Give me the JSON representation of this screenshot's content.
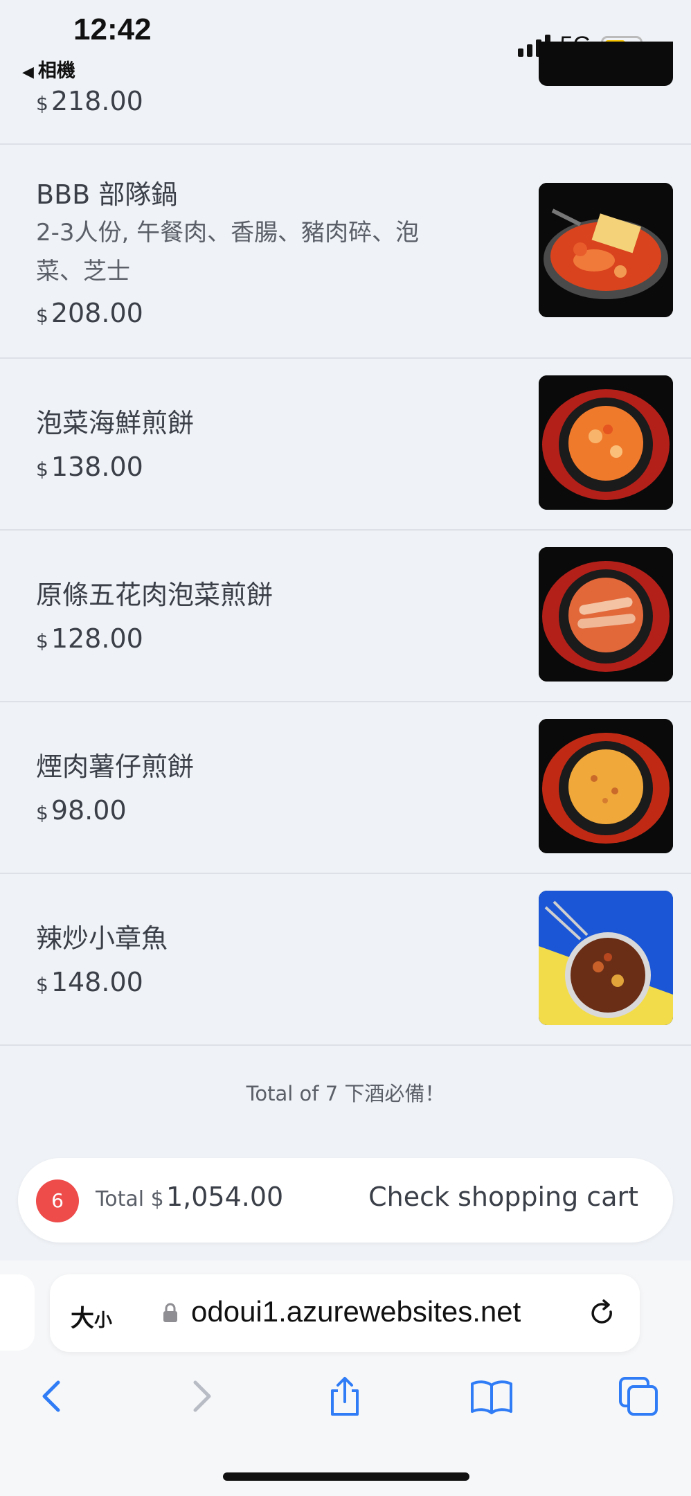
{
  "status_bar": {
    "time": "12:42",
    "back_app": "相機",
    "network": "5G"
  },
  "top_item": {
    "price_currency": "$",
    "price": "218.00"
  },
  "items": [
    {
      "name": "BBB 部隊鍋",
      "desc": "2-3人份, 午餐肉、香腸、豬肉碎、泡菜、芝士",
      "currency": "$",
      "price": "208.00",
      "image": "army-stew-photo"
    },
    {
      "name": "泡菜海鮮煎餅",
      "currency": "$",
      "price": "138.00",
      "image": "kimchi-seafood-pancake-photo"
    },
    {
      "name": "原條五花肉泡菜煎餅",
      "currency": "$",
      "price": "128.00",
      "image": "pork-belly-kimchi-pancake-photo"
    },
    {
      "name": "煙肉薯仔煎餅",
      "currency": "$",
      "price": "98.00",
      "image": "bacon-potato-pancake-photo"
    },
    {
      "name": "辣炒小章魚",
      "currency": "$",
      "price": "148.00",
      "image": "spicy-octopus-photo"
    }
  ],
  "footer_text": "Total of 7 下酒必備！",
  "cart": {
    "count": "6",
    "total_label": "Total $",
    "total_value": "1,054.00",
    "button_label": "Check shopping cart"
  },
  "browser": {
    "text_size_label": "大",
    "text_size_small": "小",
    "url": "odoui1.azurewebsites.net"
  },
  "colors": {
    "background": "#eff2f6",
    "badge": "#ee4b4b",
    "accent": "#2f7cf6"
  }
}
